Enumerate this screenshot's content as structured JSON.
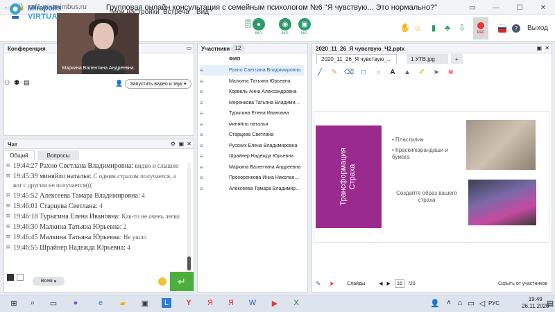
{
  "browser": {
    "url": "mf1.miranimbus.ru",
    "title": "Групповая онлайн консультация с семейным психологом №6 \"Я чувствую... Это нормально?\""
  },
  "app": {
    "brand_line1": "Mirapolis",
    "brand_line2": "VIRTUAL ROOM",
    "menu": [
      "Мои настройки",
      "Встреча",
      "Вид"
    ],
    "controls_label": "вкл.",
    "rec_label": "REC",
    "exit_label": "Выход"
  },
  "conference": {
    "title": "Конференция",
    "video_name": "Маркина Валентина  Андреевна",
    "start_button": "Запустить видео и звук"
  },
  "chat": {
    "title": "Чат",
    "tabs": [
      "Общий",
      "Вопросы"
    ],
    "messages": [
      {
        "time": "19:44:27",
        "name": "Рахно Светлана  Владимировна:",
        "text": "видно и слышно"
      },
      {
        "time": "19:45:39",
        "name": "миняйло  наталья:",
        "text": "С одним страхом получается, а вот с другим не получается((("
      },
      {
        "time": "19:45:52",
        "name": "Алексеева   Тамара  Владимировна:",
        "text": "4"
      },
      {
        "time": "19:46:01",
        "name": "Старцева  Светлана:",
        "text": "4"
      },
      {
        "time": "19:46:18",
        "name": "Турыгина  Елена  Ивановна:",
        "text": "Как-то не очень легко"
      },
      {
        "time": "19:46:30",
        "name": "Малкина Татьяна  Юрьевна:",
        "text": "2"
      },
      {
        "time": "19:46:45",
        "name": "Малкина Татьяна  Юрьевна:",
        "text": "Не ушло"
      },
      {
        "time": "19:46:55",
        "name": "Шрайнер Надежда  Юрьевна:",
        "text": "4"
      }
    ],
    "recipient": "Всем"
  },
  "participants": {
    "title": "Участники",
    "count": "12",
    "column": "ФИО",
    "list": [
      "Рахно Светлана  Владимировна",
      "Малкина Татьяна  Юрьевна",
      "Корвель Анна  Александровна",
      "Меренкова  Татьяна  Владимировна",
      "Турыгина  Елена  Ивановна",
      "миняйло  наталья",
      "Старцева  Светлана",
      "Русских Елена Владимировна",
      "Шрайнер Надежда  Юрьевна",
      "Маркина Валентина  Андреевна",
      "Прохоренкова  Инна  Николаевна",
      "Алексеева   Тамара  Владимировна"
    ]
  },
  "presentation": {
    "file_tab": "2020_11_26_Я чувствую_Ч2.pptx",
    "tab1": "2020_11_26_Я чувствую_...",
    "tab2": "1 УТВ.jpg",
    "tab_add": "+",
    "slide_title": "Трансформация Страха",
    "bullets": [
      "Пластилин",
      "Краски/карандаши и бумага"
    ],
    "caption": "Создайте образ вашего страха",
    "slides_label": "Слайды",
    "page": "16",
    "total": "/20",
    "hide_participants": "Скрыть от участников"
  },
  "taskbar": {
    "lang": "РУС",
    "time": "19:49",
    "date": "26.11.2020"
  }
}
